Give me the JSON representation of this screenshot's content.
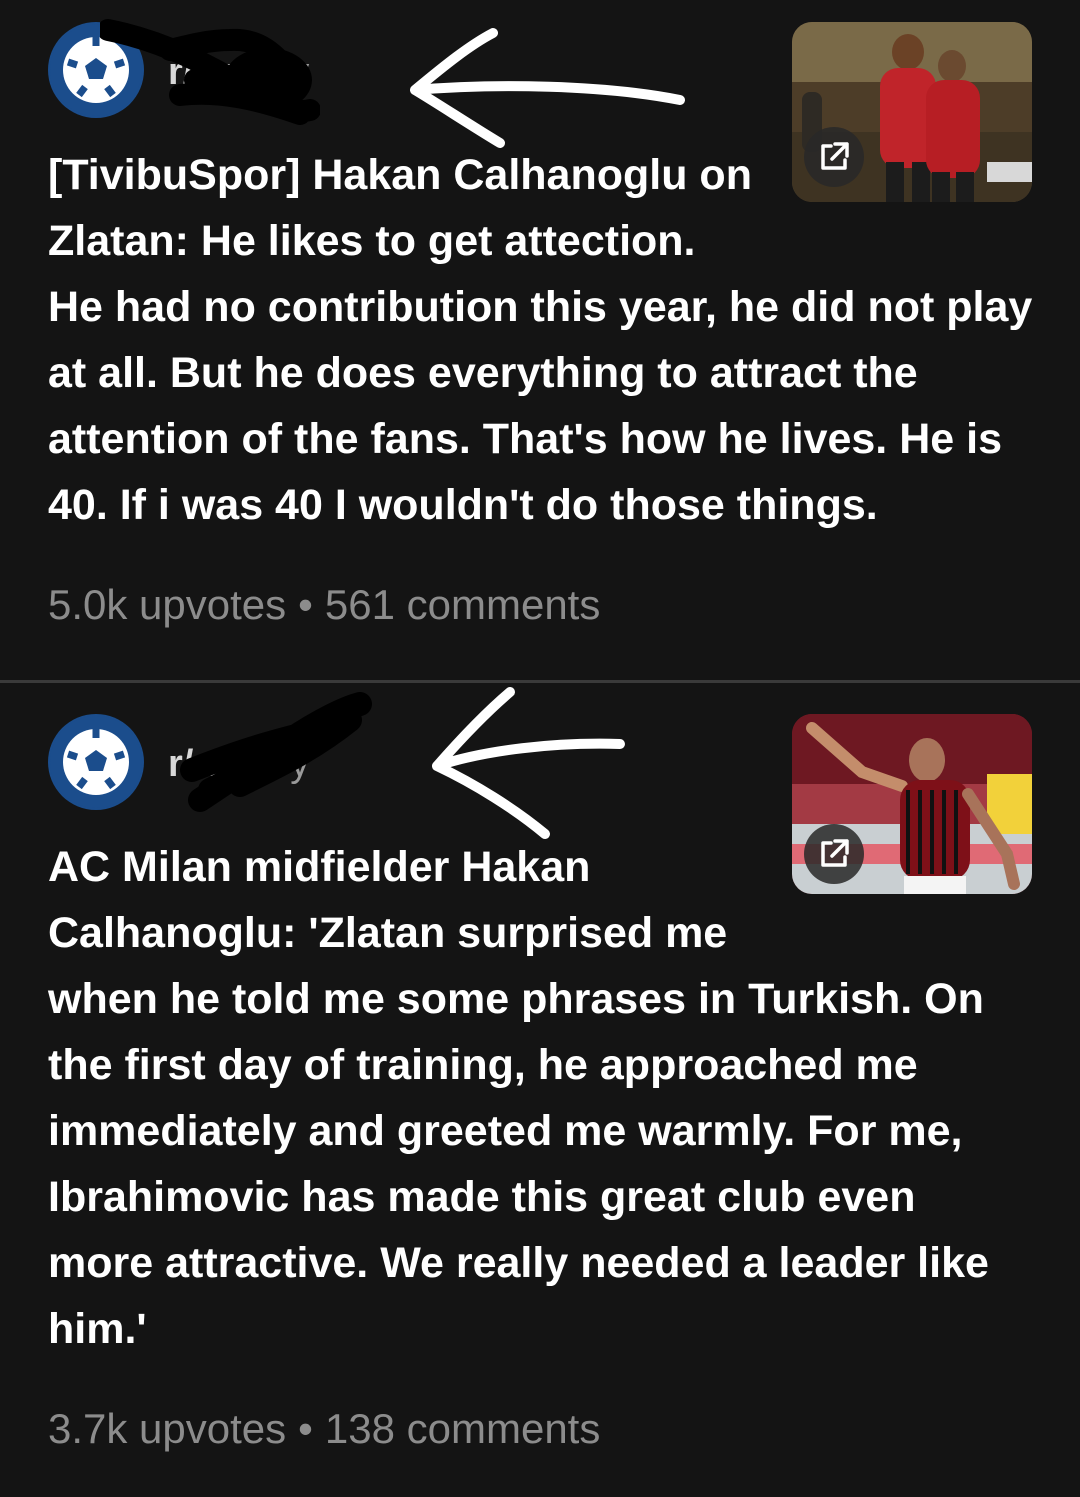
{
  "feed": {
    "posts": [
      {
        "subreddit": "r/soccer",
        "subreddit_visible": "r/      er",
        "age": "1y",
        "title_lines": "[TivibuSpor] Hakan Calhanoglu on\nZlatan: He likes to get attection.\nHe had no contribution this year, he did not play\nat all. But he does everything to attract the\nattention of the fans. That's how he lives. He is\n40. If i was 40 I wouldn't do those things.",
        "upvotes": "5.0k upvotes",
        "comments": "561 comments",
        "separator": "•",
        "avatar_icon": "soccer-ball-icon",
        "thumbnail_icon": "external-link-icon"
      },
      {
        "subreddit": "r/soccer",
        "subreddit_visible": "r/      er",
        "age": "3y",
        "title_lines": "AC Milan midfielder Hakan\nCalhanoglu: 'Zlatan surprised me\nwhen he told me some phrases in Turkish. On\nthe first day of training, he approached me\nimmediately and greeted me warmly. For me,\nIbrahimovic has made this great club even\nmore attractive. We really needed a leader like\nhim.'",
        "upvotes": "3.7k upvotes",
        "comments": "138 comments",
        "separator": "•",
        "avatar_icon": "soccer-ball-icon",
        "thumbnail_icon": "external-link-icon"
      }
    ]
  },
  "colors": {
    "background": "#141414",
    "text": "#ffffff",
    "muted": "#8c8c8c",
    "avatar": "#1b4d8c",
    "divider": "#3a3a3a"
  }
}
